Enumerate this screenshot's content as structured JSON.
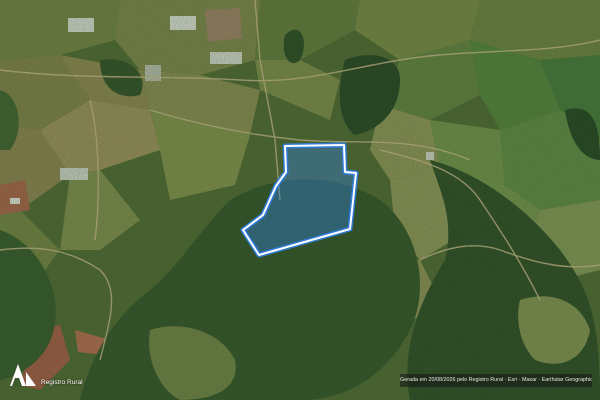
{
  "map": {
    "type": "satellite-imagery",
    "property_boundary": {
      "stroke_color": "#ffffff",
      "halo_color": "#2f7fe6",
      "fill_color": "#2f7fe6"
    },
    "colors": {
      "forest_dark": "#1f3a1c",
      "forest_mid": "#2f4f24",
      "pasture": "#6b7a3c",
      "crop_field": "#7d8a4a",
      "bare_soil": "#a0523f",
      "road": "#c9b48a"
    }
  },
  "logo": {
    "icon": "registro-rural-logo-icon",
    "label": "Registro Rural"
  },
  "attribution": {
    "text": "Gerada em 20/08/2026 pelo Registro Rural · Esri · Maxar · Earthstar Geographics"
  }
}
